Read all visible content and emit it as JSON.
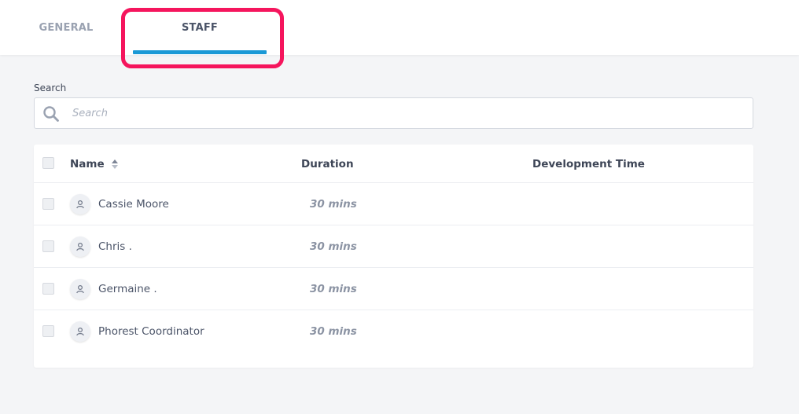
{
  "tabs": [
    {
      "label": "GENERAL",
      "active": false
    },
    {
      "label": "STAFF",
      "active": true
    }
  ],
  "colors": {
    "accent": "#1a99d6",
    "highlight": "#f5155d"
  },
  "search": {
    "label": "Search",
    "placeholder": "Search",
    "value": "",
    "icon": "search-icon"
  },
  "table": {
    "columns": [
      "Name",
      "Duration",
      "Development Time"
    ],
    "sort_icon": "sort-icon",
    "rows": [
      {
        "name": "Cassie Moore",
        "duration": "30 mins",
        "development_time": "",
        "avatar_icon": "user-icon"
      },
      {
        "name": "Chris .",
        "duration": "30 mins",
        "development_time": "",
        "avatar_icon": "user-icon"
      },
      {
        "name": "Germaine .",
        "duration": "30 mins",
        "development_time": "",
        "avatar_icon": "user-icon"
      },
      {
        "name": "Phorest Coordinator",
        "duration": "30 mins",
        "development_time": "",
        "avatar_icon": "user-icon"
      }
    ]
  }
}
